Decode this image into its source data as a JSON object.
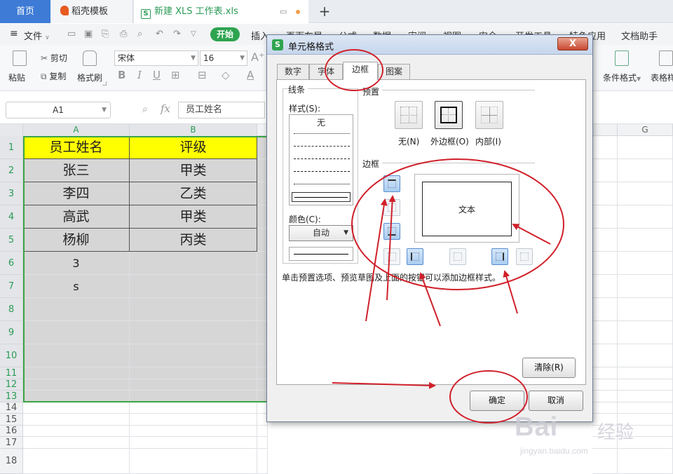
{
  "tabs": {
    "home": "首页",
    "docer": "稻壳模板",
    "file": "新建 XLS 工作表.xls",
    "add": "+"
  },
  "menu": {
    "hamburger": "≡",
    "file": "文件",
    "start": "开始",
    "items": [
      "插入",
      "页面布局",
      "公式",
      "数据",
      "审阅",
      "视图",
      "安全",
      "开发工具",
      "特色应用",
      "文档助手"
    ]
  },
  "ribbon": {
    "paste": "粘贴",
    "cut": "剪切",
    "copy": "复制",
    "format_painter": "格式刷",
    "font_name": "宋体",
    "font_size": "16",
    "cond_format": "条件格式",
    "table_style": "表格样"
  },
  "formula_bar": {
    "cell_ref": "A1",
    "fx": "fx",
    "value": "员工姓名"
  },
  "sheet": {
    "columns": [
      "A",
      "B",
      "G"
    ],
    "rows": [
      "1",
      "2",
      "3",
      "4",
      "5",
      "6",
      "7",
      "8",
      "9",
      "10",
      "11",
      "12",
      "13",
      "14",
      "15",
      "16",
      "17",
      "18"
    ],
    "colA": [
      "员工姓名",
      "张三",
      "李四",
      "高武",
      "杨柳",
      "3",
      "s"
    ],
    "colB": [
      "评级",
      "甲类",
      "乙类",
      "甲类",
      "丙类",
      "",
      ""
    ]
  },
  "dialog": {
    "title": "单元格格式",
    "close": "X",
    "tabs": [
      "数字",
      "字体",
      "边框",
      "图案"
    ],
    "active_tab": "边框",
    "line_group": "线条",
    "style_label": "样式(S):",
    "style_none": "无",
    "color_label": "颜色(C):",
    "color_value": "自动",
    "preset_group": "预置",
    "preset_none": "无(N)",
    "preset_outline": "外边框(O)",
    "preset_inside": "内部(I)",
    "border_group": "边框",
    "preview_text": "文本",
    "hint": "单击预置选项、预览草图及上面的按钮可以添加边框样式。",
    "clear": "清除(R)",
    "ok": "确定",
    "cancel": "取消"
  },
  "watermark": {
    "brand": "Bai",
    "jingyan": "经验",
    "url": "jingyan.baidu.com"
  },
  "colors": {
    "accent": "#3d7bd6",
    "green": "#2ea44f",
    "header_fill": "#ffff00",
    "shade_fill": "#d6d6d6",
    "annotation": "#d0202a"
  }
}
